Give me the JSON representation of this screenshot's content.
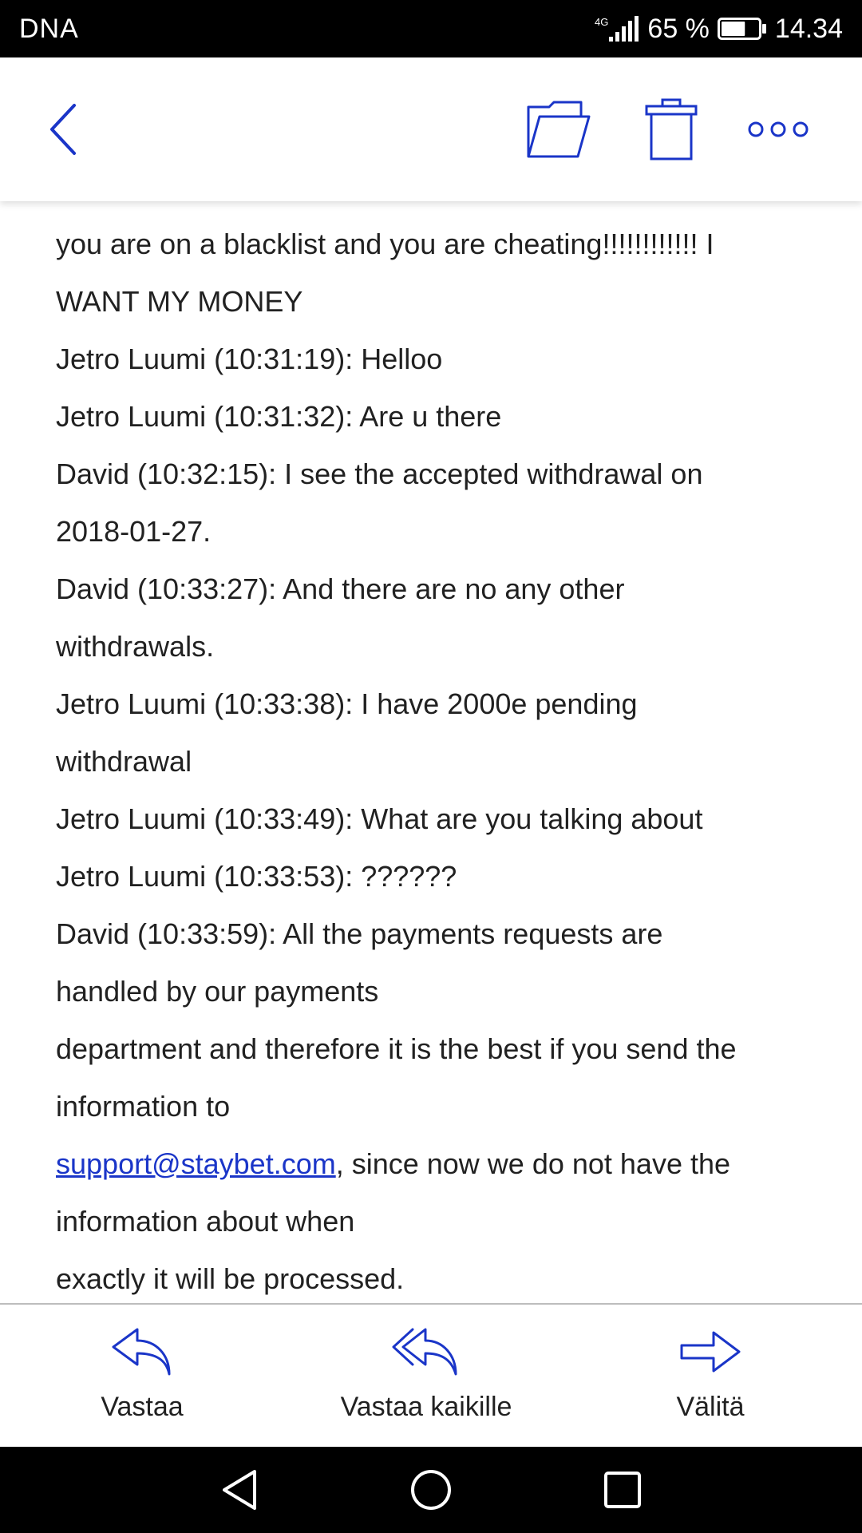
{
  "status_bar": {
    "carrier": "DNA",
    "network": "4G",
    "battery_text": "65 %",
    "battery_level": 0.65,
    "time": "14.34"
  },
  "toolbar": {
    "back_icon": "chevron-left-icon",
    "folder_icon": "folder-icon",
    "trash_icon": "trash-icon",
    "more_icon": "more-horizontal-icon",
    "accent_color": "#1a35c8"
  },
  "message": {
    "lines": [
      {
        "text": "you are on a blacklist and you are cheating!!!!!!!!!!!! I"
      },
      {
        "text": "WANT MY MONEY"
      },
      {
        "text": "Jetro Luumi (10:31:19): Helloo"
      },
      {
        "text": "Jetro Luumi (10:31:32): Are u there"
      },
      {
        "text": "David (10:32:15): I see the accepted withdrawal on"
      },
      {
        "text": "2018-01-27."
      },
      {
        "text": "David (10:33:27): And there are no any other"
      },
      {
        "text": "withdrawals."
      },
      {
        "text": "Jetro Luumi (10:33:38): I have 2000e pending"
      },
      {
        "text": "withdrawal"
      },
      {
        "text": "Jetro Luumi (10:33:49): What are you talking about"
      },
      {
        "text": "Jetro Luumi (10:33:53): ??????"
      },
      {
        "text": "David (10:33:59): All the payments requests are"
      },
      {
        "text": "handled by our payments"
      },
      {
        "text": "department and therefore it is the best if you send the"
      },
      {
        "text": "information to"
      },
      {
        "link": "support@staybet.com",
        "text": ", since now we do not have the"
      },
      {
        "text": "information about when"
      },
      {
        "text": "exactly it will be processed."
      }
    ]
  },
  "actions": {
    "reply": "Vastaa",
    "reply_all": "Vastaa kaikille",
    "forward": "Välitä"
  },
  "nav": {
    "back_icon": "triangle-back-icon",
    "home_icon": "circle-home-icon",
    "recent_icon": "square-recent-icon"
  }
}
